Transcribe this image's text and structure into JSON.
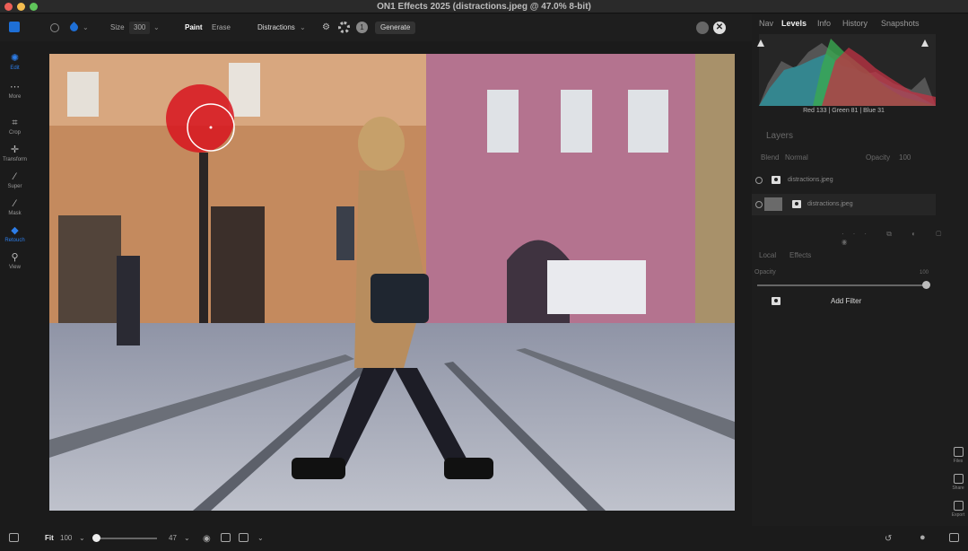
{
  "window": {
    "title": "ON1 Effects 2025 (distractions.jpeg @ 47.0% 8-bit)"
  },
  "toolbar": {
    "size_label": "Size",
    "size_value": "300",
    "paint_label": "Paint",
    "erase_label": "Erase",
    "mode_value": "Distractions",
    "badge_value": "1",
    "generate_label": "Generate",
    "cancel_glyph": "✕"
  },
  "tools": [
    {
      "label": "Edit",
      "icon": "edit-icon",
      "active": true
    },
    {
      "label": "More",
      "icon": "more-icon"
    },
    {
      "label": "Crop",
      "icon": "crop-icon"
    },
    {
      "label": "Transform",
      "icon": "transform-icon"
    },
    {
      "label": "Super",
      "icon": "super-brush-icon"
    },
    {
      "label": "Mask",
      "icon": "mask-brush-icon"
    },
    {
      "label": "Retouch",
      "icon": "retouch-icon",
      "active": true
    },
    {
      "label": "View",
      "icon": "view-icon"
    }
  ],
  "right_panel": {
    "tabs": [
      "Nav",
      "Levels",
      "Info",
      "History",
      "Snapshots"
    ],
    "active_tab": "Levels",
    "rgb_readout": "Red 133 | Green 81 | Blue 31",
    "layers": {
      "title": "Layers",
      "blend_label": "Blend",
      "blend_value": "Normal",
      "opacity_label": "Opacity",
      "opacity_value": "100",
      "items": [
        {
          "name": "distractions.jpeg"
        },
        {
          "name": "distractions.jpeg",
          "selected": true
        }
      ]
    },
    "filter_tabs": [
      "Local",
      "Effects"
    ],
    "filter_opacity_label": "Opacity",
    "filter_opacity_value": "100",
    "add_filter_label": "Add Filter",
    "side_buttons": [
      "Files",
      "Share",
      "Export"
    ]
  },
  "bottom": {
    "fit_label": "Fit",
    "zoom_percent": "100",
    "zoom_value": "47"
  },
  "colors": {
    "accent": "#2d7de8",
    "brush_overlay": "#d8141e",
    "building_left": "#c48a5e",
    "building_right": "#b4738f"
  }
}
